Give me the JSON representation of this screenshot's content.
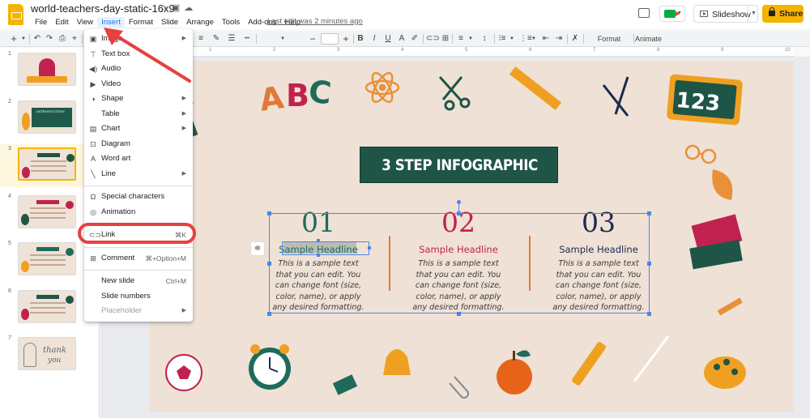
{
  "app": {
    "doc_title": "world-teachers-day-static-16x9",
    "last_edit": "Last edit was 2 minutes ago",
    "menus": [
      "File",
      "Edit",
      "View",
      "Insert",
      "Format",
      "Slide",
      "Arrange",
      "Tools",
      "Add-ons",
      "Help"
    ],
    "active_menu": "Insert",
    "slideshow_label": "Slideshow",
    "share_label": "Share"
  },
  "toolbar": {
    "format_options": "Format options",
    "animate": "Animate"
  },
  "ruler": [
    "1",
    "1",
    "2",
    "3",
    "4",
    "5",
    "6",
    "7",
    "8",
    "9",
    "10"
  ],
  "filmstrip": {
    "slide_numbers": [
      "1",
      "2",
      "3",
      "4",
      "5",
      "6",
      "7"
    ],
    "selected": 3,
    "thumb2_title": "INTRODUCTION",
    "thumb7_text1": "thank",
    "thumb7_text2": "you"
  },
  "insert_menu": [
    {
      "label": "Image",
      "icon": "image-icon",
      "submenu": true
    },
    {
      "label": "Text box",
      "icon": "text-box-icon"
    },
    {
      "label": "Audio",
      "icon": "audio-icon"
    },
    {
      "label": "Video",
      "icon": "video-icon"
    },
    {
      "label": "Shape",
      "icon": "shape-icon",
      "submenu": true
    },
    {
      "label": "Table",
      "submenu": true
    },
    {
      "label": "Chart",
      "icon": "chart-icon",
      "submenu": true
    },
    {
      "label": "Diagram",
      "icon": "diagram-icon"
    },
    {
      "label": "Word art",
      "icon": "word-art-icon"
    },
    {
      "label": "Line",
      "icon": "line-icon",
      "submenu": true
    },
    {
      "label": "Special characters",
      "icon": "omega-icon"
    },
    {
      "label": "Animation",
      "icon": "animation-icon"
    },
    {
      "label": "Link",
      "icon": "link-icon",
      "shortcut": "⌘K"
    },
    {
      "label": "Comment",
      "icon": "comment-icon",
      "shortcut": "⌘+Option+M"
    },
    {
      "label": "New slide",
      "shortcut": "Ctrl+M"
    },
    {
      "label": "Slide numbers"
    },
    {
      "label": "Placeholder",
      "disabled": true,
      "submenu": true
    }
  ],
  "slide": {
    "title": "3 STEP INFOGRAPHIC",
    "abc": "ABC",
    "board_number": "123",
    "steps": [
      {
        "number": "01",
        "headline": "Sample Headline",
        "body": [
          "This is a sample text",
          "that you can edit. You",
          "can change font (size,",
          "color, name), or apply",
          "any desired formatting."
        ],
        "color": "#1e6b5c"
      },
      {
        "number": "02",
        "headline": "Sample Headline",
        "body": [
          "This is a sample text",
          "that you can edit. You",
          "can change font (size,",
          "color, name), or apply",
          "any desired formatting."
        ],
        "color": "#c0224f"
      },
      {
        "number": "03",
        "headline": "Sample Headline",
        "body": [
          "This is a sample text",
          "that you can edit. You",
          "can change font (size,",
          "color, name), or apply",
          "any desired formatting."
        ],
        "color": "#1c2a4f"
      }
    ]
  },
  "colors": {
    "accent": "#1a73e8",
    "share": "#f4b400",
    "selection": "#4a86e8",
    "highlight_ring": "#e8403f",
    "title_box": "#1e5546",
    "slide_bg": "#efe1d5"
  }
}
